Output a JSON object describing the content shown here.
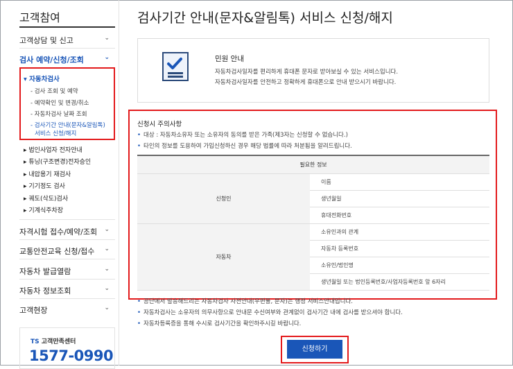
{
  "sidebar": {
    "title": "고객참여",
    "menu": [
      {
        "label": "고객상담 및 신고"
      },
      {
        "label": "검사 예약/신청/조회"
      }
    ],
    "active_sub": "자동차검사",
    "sub_items": [
      "검사 조회 및 예약",
      "예약확인 및 변경/취소",
      "자동차검사 날짜 조회"
    ],
    "current_line1": "검사기간 안내(문자&알림톡)",
    "current_line2": "서비스 신청/해지",
    "other_subs": [
      "법인사업자 전자안내",
      "튜닝(구조변경)전자승인",
      "내압용기 재검사",
      "기기정도 검사",
      "궤도(삭도)검사",
      "기계식주차장"
    ],
    "lower_menu": [
      "자격시험 접수/예약/조회",
      "교통안전교육 신청/접수",
      "자동차 발급열람",
      "자동차 정보조회",
      "고객현장"
    ],
    "cs_logo": "TS",
    "cs_label": "고객만족센터",
    "cs_phone": "1577-0990"
  },
  "main": {
    "title": "검사기간 안내(문자&알림톡) 서비스 신청/해지",
    "info_title": "민원 안내",
    "info_lines": [
      "자동차검사일자를 편리하게 휴대폰 문자로 받아보실 수 있는 서비스입니다.",
      "자동차검사일자를 안전하고 정확하게 휴대폰으로 안내 받으시기 바랍니다."
    ],
    "notice_title": "신청시 주의사항",
    "notice_bullets": [
      "대상 : 자동차소유자 또는 소유자의 동의를 받은 가족(제3자는 신청할 수 없습니다.)",
      "타인의 정보를 도용하여 가입신청하신 경우 해당 법률에 따라 처분됨을 알려드립니다."
    ],
    "table_header": "필요한 정보",
    "applicant_label": "신청인",
    "applicant_items": [
      "이름",
      "생년월일",
      "휴대전화번호"
    ],
    "vehicle_label": "자동차",
    "vehicle_items": [
      "소유인과의 관계",
      "자동차 등록번호",
      "소유인/법인명",
      "생년월일 또는 법인등록번호/사업자등록번호 앞 6자리"
    ],
    "footer_bullets": [
      "공단에서 발송해드리는 자동차검사 사전안내(우편물, 문자)는 행정 서비스안내입니다.",
      "자동차검사는 소유자의 의무사항으로 안내문 수신여부와 관계없이 검사기간 내에 검사를 받으셔야 합니다.",
      "자동차등록증을 통해 수시로 검사기간을 확인하주시길 바랍니다."
    ],
    "apply_button": "신청하기"
  },
  "colors": {
    "accent": "#1a56b8",
    "highlight": "#e3191b"
  }
}
